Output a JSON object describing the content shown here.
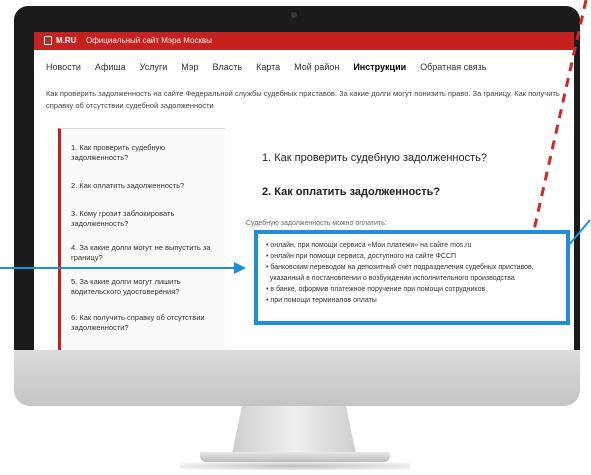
{
  "header": {
    "site": "M.RU",
    "official_text": "Официальный сайт Мэра Москвы"
  },
  "nav": {
    "items": [
      "Новости",
      "Афиша",
      "Услуги",
      "Мэр",
      "Власть",
      "Карта",
      "Мой район",
      "Инструкции",
      "Обратная связь"
    ]
  },
  "intro": {
    "text": "Как проверить задолженность на сайте Федеральной службы судебных приставов. За какие долги могут понизить право. За границу. Как получить справку об отсутствии судебной задолженности"
  },
  "sidebar": {
    "items": [
      "1. Как проверить судебную задолженность?",
      "2. Как оплатить задолженность?",
      "3. Кому грозит заблокировать задолженность?",
      "4. За какие долги могут не выпустить за границу?",
      "5. За какие долги могут лишить водительского удостоверения?",
      "6. Как получить справку об отсутствии задолженности?"
    ]
  },
  "content": {
    "heading1": "1. Как проверить судебную задолженность?",
    "heading2": "2. Как оплатить задолженность?",
    "subtitle": "Судебную задолженность можно оплатить:",
    "list": [
      "онлайн, при помощи сервиса «Мои платежи» на сайте mos.ru",
      "онлайн при помощи сервиса, доступного на сайте ФССП",
      "банковским переводом на депозитный счет подразделения судебных приставов,",
      "указанный в постановлении о возбуждении исполнительного производства",
      "в банке, оформив платежное поручение при помощи сотрудников",
      "при помощи терминалов оплаты"
    ]
  },
  "colors": {
    "brand_red": "#c5221f",
    "callout_blue": "#1e8fd8"
  }
}
